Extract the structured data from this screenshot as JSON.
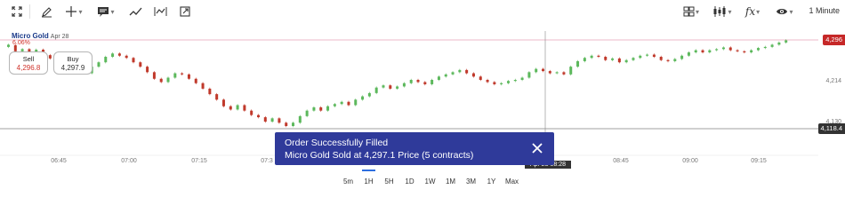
{
  "toolbar": {
    "icons": [
      "fullscreen-icon",
      "pencil-icon",
      "crosshair-icon",
      "annotation-icon",
      "trendline-icon",
      "measure-icon",
      "expand-icon",
      "layout-grid-icon",
      "candles-icon",
      "function-icon",
      "eye-icon"
    ],
    "interval_label": "1 Minute"
  },
  "instrument": {
    "name": "Micro Gold",
    "date": "Apr 28",
    "change": "6.06%"
  },
  "trade": {
    "sell_label": "Sell",
    "sell_price": "4,296.8",
    "buy_label": "Buy",
    "buy_price": "4,297.9"
  },
  "price_axis": {
    "current_price_tag": "4,296",
    "mid_label": "4,214",
    "low_label": "4,130",
    "crosshair_price_tag": "4,118.4"
  },
  "time_axis": {
    "labels": [
      "06:45",
      "07:00",
      "07:15",
      "07:3",
      "08:45",
      "09:00",
      "09:15"
    ],
    "crosshair_time_tag": "Apr 28 08:28"
  },
  "ranges": [
    "5m",
    "1H",
    "5H",
    "1D",
    "1W",
    "1M",
    "3M",
    "1Y",
    "Max"
  ],
  "active_range": "1H",
  "toast": {
    "title": "Order Successfully Filled",
    "message": "Micro Gold Sold at 4,297.1 Price (5 contracts)"
  },
  "colors": {
    "up": "#5cb85c",
    "down": "#c0392b",
    "toast_bg": "#2f3a9a",
    "price_tag": "#c62828",
    "active_range": "#2e6fe0"
  },
  "chart_data": {
    "type": "candlestick",
    "y_range": [
      4100,
      4310
    ],
    "candles": [
      [
        4286,
        4290
      ],
      [
        4289,
        4278
      ],
      [
        4278,
        4282
      ],
      [
        4282,
        4276
      ],
      [
        4276,
        4281
      ],
      [
        4281,
        4271
      ],
      [
        4271,
        4265
      ],
      [
        4265,
        4274
      ],
      [
        4274,
        4267
      ],
      [
        4267,
        4259
      ],
      [
        4259,
        4248
      ],
      [
        4248,
        4238
      ],
      [
        4238,
        4250
      ],
      [
        4250,
        4258
      ],
      [
        4258,
        4268
      ],
      [
        4268,
        4274
      ],
      [
        4274,
        4270
      ],
      [
        4270,
        4266
      ],
      [
        4266,
        4258
      ],
      [
        4258,
        4250
      ],
      [
        4250,
        4240
      ],
      [
        4240,
        4228
      ],
      [
        4228,
        4222
      ],
      [
        4222,
        4230
      ],
      [
        4230,
        4238
      ],
      [
        4238,
        4236
      ],
      [
        4236,
        4228
      ],
      [
        4228,
        4220
      ],
      [
        4220,
        4210
      ],
      [
        4210,
        4200
      ],
      [
        4200,
        4190
      ],
      [
        4190,
        4178
      ],
      [
        4178,
        4172
      ],
      [
        4172,
        4180
      ],
      [
        4180,
        4170
      ],
      [
        4170,
        4162
      ],
      [
        4162,
        4158
      ],
      [
        4158,
        4150
      ],
      [
        4150,
        4156
      ],
      [
        4156,
        4148
      ],
      [
        4148,
        4142
      ],
      [
        4142,
        4148
      ],
      [
        4148,
        4160
      ],
      [
        4160,
        4170
      ],
      [
        4170,
        4176
      ],
      [
        4176,
        4170
      ],
      [
        4170,
        4178
      ],
      [
        4178,
        4182
      ],
      [
        4182,
        4186
      ],
      [
        4186,
        4180
      ],
      [
        4180,
        4190
      ],
      [
        4190,
        4196
      ],
      [
        4196,
        4202
      ],
      [
        4202,
        4212
      ],
      [
        4212,
        4216
      ],
      [
        4216,
        4210
      ],
      [
        4210,
        4214
      ],
      [
        4214,
        4220
      ],
      [
        4220,
        4226
      ],
      [
        4226,
        4222
      ],
      [
        4222,
        4218
      ],
      [
        4218,
        4226
      ],
      [
        4226,
        4232
      ],
      [
        4232,
        4236
      ],
      [
        4236,
        4240
      ],
      [
        4240,
        4244
      ],
      [
        4244,
        4238
      ],
      [
        4238,
        4232
      ],
      [
        4232,
        4226
      ],
      [
        4226,
        4222
      ],
      [
        4222,
        4218
      ],
      [
        4218,
        4220
      ],
      [
        4220,
        4224
      ],
      [
        4224,
        4226
      ],
      [
        4226,
        4230
      ],
      [
        4230,
        4240
      ],
      [
        4240,
        4246
      ],
      [
        4246,
        4242
      ],
      [
        4242,
        4238
      ],
      [
        4238,
        4240
      ],
      [
        4240,
        4236
      ],
      [
        4236,
        4250
      ],
      [
        4250,
        4260
      ],
      [
        4260,
        4266
      ],
      [
        4266,
        4270
      ],
      [
        4270,
        4268
      ],
      [
        4268,
        4262
      ],
      [
        4262,
        4265
      ],
      [
        4265,
        4258
      ],
      [
        4258,
        4262
      ],
      [
        4262,
        4266
      ],
      [
        4266,
        4270
      ],
      [
        4270,
        4272
      ],
      [
        4272,
        4268
      ],
      [
        4268,
        4262
      ],
      [
        4262,
        4260
      ],
      [
        4260,
        4264
      ],
      [
        4264,
        4270
      ],
      [
        4270,
        4276
      ],
      [
        4276,
        4280
      ],
      [
        4280,
        4276
      ],
      [
        4276,
        4280
      ],
      [
        4280,
        4282
      ],
      [
        4282,
        4285
      ],
      [
        4285,
        4280
      ],
      [
        4280,
        4278
      ],
      [
        4278,
        4276
      ],
      [
        4276,
        4280
      ],
      [
        4280,
        4284
      ],
      [
        4284,
        4286
      ],
      [
        4286,
        4290
      ],
      [
        4290,
        4294
      ],
      [
        4294,
        4298
      ]
    ]
  }
}
